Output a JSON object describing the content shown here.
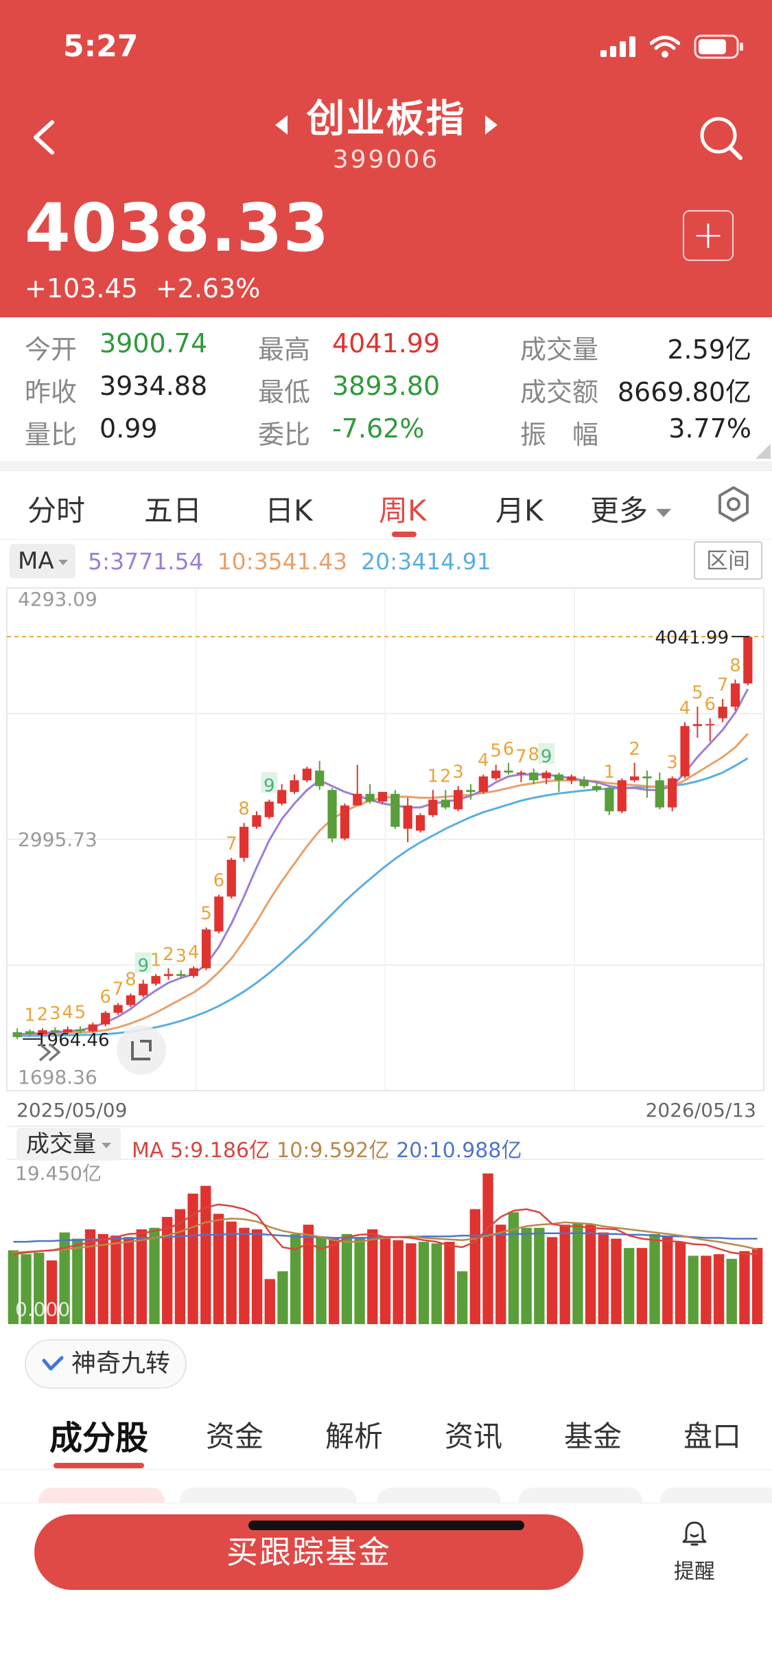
{
  "status": {
    "time": "5:27"
  },
  "header": {
    "title": "创业板指",
    "code": "399006",
    "price": "4038.33",
    "change": "+103.45",
    "change_pct": "+2.63%",
    "add_label": "+"
  },
  "stats": [
    [
      {
        "label": "今开",
        "value": "3900.74",
        "color": "green"
      },
      {
        "label": "最高",
        "value": "4041.99",
        "color": "red"
      },
      {
        "label": "成交量",
        "value": "2.59亿",
        "color": "black"
      }
    ],
    [
      {
        "label": "昨收",
        "value": "3934.88",
        "color": "black"
      },
      {
        "label": "最低",
        "value": "3893.80",
        "color": "green"
      },
      {
        "label": "成交额",
        "value": "8669.80亿",
        "color": "black"
      }
    ],
    [
      {
        "label": "量比",
        "value": "0.99",
        "color": "black"
      },
      {
        "label": "委比",
        "value": "-7.62%",
        "color": "green"
      },
      {
        "label": "振　幅",
        "value": "3.77%",
        "color": "black"
      }
    ]
  ],
  "period_tabs": [
    "分时",
    "五日",
    "日K",
    "周K",
    "月K",
    "更多"
  ],
  "active_period": "周K",
  "ma": {
    "select": "MA",
    "ma5": "5:3771.54",
    "ma10": "10:3541.43",
    "ma20": "20:3414.91",
    "range_btn": "区间"
  },
  "colors": {
    "up": "#e0332f",
    "down": "#5a9e3a",
    "ma5": "#9b7fd6",
    "ma10": "#e8a06a",
    "ma20": "#5aaee0",
    "nine_up": "#e8a53a",
    "nine_down": "#4cb07a",
    "header": "#e04a46"
  },
  "chart_data": {
    "type": "candlestick",
    "ylim": [
      1698.36,
      4293.09
    ],
    "y_labels": [
      "4293.09",
      "2995.73",
      "1698.36"
    ],
    "x_start": "2025/05/09",
    "x_end": "2026/05/13",
    "high_marker": "4041.99",
    "low_marker": "1964.46",
    "candles": [
      [
        2000,
        1975,
        2020,
        1964
      ],
      [
        2005,
        1990,
        2015,
        1980
      ],
      [
        1988,
        2010,
        2020,
        1980
      ],
      [
        2010,
        2000,
        2025,
        1990
      ],
      [
        2000,
        2015,
        2030,
        1995
      ],
      [
        2015,
        2005,
        2030,
        1995
      ],
      [
        2005,
        2040,
        2050,
        2000
      ],
      [
        2040,
        2100,
        2110,
        2030
      ],
      [
        2100,
        2140,
        2150,
        2090
      ],
      [
        2140,
        2190,
        2200,
        2130
      ],
      [
        2190,
        2250,
        2270,
        2180
      ],
      [
        2250,
        2290,
        2300,
        2240
      ],
      [
        2290,
        2300,
        2330,
        2270
      ],
      [
        2300,
        2290,
        2320,
        2280
      ],
      [
        2290,
        2330,
        2340,
        2280
      ],
      [
        2330,
        2530,
        2540,
        2320
      ],
      [
        2520,
        2700,
        2710,
        2510
      ],
      [
        2700,
        2890,
        2900,
        2690
      ],
      [
        2900,
        3060,
        3080,
        2880
      ],
      [
        3060,
        3120,
        3140,
        3050
      ],
      [
        3110,
        3190,
        3200,
        3100
      ],
      [
        3180,
        3250,
        3280,
        3170
      ],
      [
        3240,
        3300,
        3330,
        3230
      ],
      [
        3300,
        3360,
        3370,
        3290
      ],
      [
        3350,
        3270,
        3400,
        3250
      ],
      [
        3250,
        3000,
        3260,
        2980
      ],
      [
        3000,
        3170,
        3180,
        2990
      ],
      [
        3170,
        3230,
        3380,
        3170
      ],
      [
        3230,
        3190,
        3280,
        3180
      ],
      [
        3190,
        3240,
        3240,
        3180
      ],
      [
        3230,
        3060,
        3250,
        3050
      ],
      [
        3050,
        3170,
        3210,
        2980
      ],
      [
        3040,
        3120,
        3130,
        3030
      ],
      [
        3120,
        3200,
        3250,
        3110
      ],
      [
        3200,
        3160,
        3250,
        3150
      ],
      [
        3150,
        3250,
        3270,
        3140
      ],
      [
        3250,
        3240,
        3280,
        3200
      ],
      [
        3240,
        3320,
        3330,
        3230
      ],
      [
        3310,
        3350,
        3380,
        3300
      ],
      [
        3350,
        3340,
        3390,
        3330
      ],
      [
        3340,
        3340,
        3350,
        3290
      ],
      [
        3340,
        3300,
        3360,
        3280
      ],
      [
        3310,
        3340,
        3350,
        3280
      ],
      [
        3330,
        3300,
        3340,
        3240
      ],
      [
        3300,
        3320,
        3330,
        3280
      ],
      [
        3300,
        3270,
        3320,
        3260
      ],
      [
        3270,
        3250,
        3290,
        3240
      ],
      [
        3260,
        3140,
        3270,
        3120
      ],
      [
        3140,
        3300,
        3310,
        3130
      ],
      [
        3300,
        3320,
        3390,
        3290
      ],
      [
        3320,
        3310,
        3350,
        3210
      ],
      [
        3300,
        3160,
        3340,
        3150
      ],
      [
        3160,
        3310,
        3320,
        3140
      ],
      [
        3320,
        3580,
        3600,
        3310
      ],
      [
        3580,
        3590,
        3680,
        3520
      ],
      [
        3590,
        3590,
        3620,
        3500
      ],
      [
        3620,
        3680,
        3720,
        3600
      ],
      [
        3680,
        3800,
        3820,
        3660
      ],
      [
        3800,
        4040,
        4042,
        3790
      ]
    ],
    "nine_counts": [
      {
        "i": 1,
        "n": "1",
        "t": "up"
      },
      {
        "i": 2,
        "n": "2",
        "t": "up"
      },
      {
        "i": 3,
        "n": "3",
        "t": "up"
      },
      {
        "i": 4,
        "n": "4",
        "t": "up"
      },
      {
        "i": 5,
        "n": "5",
        "t": "up"
      },
      {
        "i": 7,
        "n": "6",
        "t": "up"
      },
      {
        "i": 8,
        "n": "7",
        "t": "up"
      },
      {
        "i": 9,
        "n": "8",
        "t": "up"
      },
      {
        "i": 10,
        "n": "9",
        "t": "down"
      },
      {
        "i": 11,
        "n": "1",
        "t": "up"
      },
      {
        "i": 12,
        "n": "2",
        "t": "up"
      },
      {
        "i": 13,
        "n": "3",
        "t": "up"
      },
      {
        "i": 14,
        "n": "4",
        "t": "up"
      },
      {
        "i": 15,
        "n": "5",
        "t": "up"
      },
      {
        "i": 16,
        "n": "6",
        "t": "up"
      },
      {
        "i": 17,
        "n": "7",
        "t": "up"
      },
      {
        "i": 18,
        "n": "8",
        "t": "up"
      },
      {
        "i": 20,
        "n": "9",
        "t": "down"
      },
      {
        "i": 33,
        "n": "1",
        "t": "up"
      },
      {
        "i": 34,
        "n": "2",
        "t": "up"
      },
      {
        "i": 35,
        "n": "3",
        "t": "up"
      },
      {
        "i": 37,
        "n": "4",
        "t": "up"
      },
      {
        "i": 38,
        "n": "5",
        "t": "up"
      },
      {
        "i": 39,
        "n": "6",
        "t": "up"
      },
      {
        "i": 40,
        "n": "7",
        "t": "up"
      },
      {
        "i": 41,
        "n": "8",
        "t": "up"
      },
      {
        "i": 42,
        "n": "9",
        "t": "down"
      },
      {
        "i": 47,
        "n": "1",
        "t": "up"
      },
      {
        "i": 49,
        "n": "2",
        "t": "up"
      },
      {
        "i": 52,
        "n": "3",
        "t": "up"
      },
      {
        "i": 53,
        "n": "4",
        "t": "up"
      },
      {
        "i": 54,
        "n": "5",
        "t": "up"
      },
      {
        "i": 55,
        "n": "6",
        "t": "up"
      },
      {
        "i": 56,
        "n": "7",
        "t": "up"
      },
      {
        "i": 57,
        "n": "8",
        "t": "up"
      }
    ],
    "ma5": [
      1990,
      1992,
      1995,
      2000,
      2005,
      2010,
      2025,
      2050,
      2080,
      2120,
      2170,
      2215,
      2255,
      2280,
      2300,
      2350,
      2440,
      2560,
      2700,
      2850,
      2990,
      3100,
      3180,
      3250,
      3300,
      3270,
      3240,
      3220,
      3200,
      3180,
      3170,
      3160,
      3160,
      3180,
      3190,
      3200,
      3220,
      3250,
      3290,
      3320,
      3330,
      3330,
      3330,
      3320,
      3310,
      3300,
      3290,
      3270,
      3260,
      3260,
      3250,
      3250,
      3270,
      3340,
      3420,
      3490,
      3560,
      3650,
      3771
    ],
    "ma10": [
      1985,
      1988,
      1990,
      1992,
      1995,
      1998,
      2002,
      2010,
      2025,
      2045,
      2070,
      2100,
      2135,
      2170,
      2205,
      2250,
      2310,
      2380,
      2470,
      2570,
      2680,
      2780,
      2870,
      2960,
      3040,
      3100,
      3140,
      3170,
      3195,
      3210,
      3215,
      3215,
      3210,
      3210,
      3215,
      3220,
      3225,
      3235,
      3245,
      3260,
      3275,
      3285,
      3295,
      3300,
      3300,
      3300,
      3295,
      3285,
      3280,
      3275,
      3270,
      3265,
      3270,
      3300,
      3340,
      3380,
      3420,
      3470,
      3541
    ],
    "ma20": [
      1980,
      1981,
      1982,
      1983,
      1984,
      1985,
      1987,
      1990,
      1995,
      2002,
      2012,
      2025,
      2040,
      2058,
      2080,
      2105,
      2135,
      2170,
      2210,
      2255,
      2305,
      2360,
      2420,
      2480,
      2545,
      2610,
      2675,
      2735,
      2790,
      2845,
      2895,
      2940,
      2980,
      3015,
      3050,
      3080,
      3110,
      3135,
      3155,
      3175,
      3195,
      3210,
      3222,
      3232,
      3240,
      3247,
      3253,
      3257,
      3260,
      3263,
      3265,
      3268,
      3272,
      3280,
      3295,
      3315,
      3340,
      3375,
      3414
    ]
  },
  "volume": {
    "select": "成交量",
    "ma5": "MA 5:9.186亿",
    "ma10": "10:9.592亿",
    "ma20": "20:10.988亿",
    "max_label": "19.450亿",
    "min_label": "0.000",
    "bars": [
      {
        "v": 9.5,
        "t": "down"
      },
      {
        "v": 9.0,
        "t": "down"
      },
      {
        "v": 9.2,
        "t": "down"
      },
      {
        "v": 8.2,
        "t": "up"
      },
      {
        "v": 11.8,
        "t": "down"
      },
      {
        "v": 11.0,
        "t": "down"
      },
      {
        "v": 12.2,
        "t": "up"
      },
      {
        "v": 11.6,
        "t": "up"
      },
      {
        "v": 11.4,
        "t": "up"
      },
      {
        "v": 11.2,
        "t": "up"
      },
      {
        "v": 12.2,
        "t": "up"
      },
      {
        "v": 12.4,
        "t": "down"
      },
      {
        "v": 13.8,
        "t": "up"
      },
      {
        "v": 14.8,
        "t": "up"
      },
      {
        "v": 16.8,
        "t": "up"
      },
      {
        "v": 17.8,
        "t": "up"
      },
      {
        "v": 14.2,
        "t": "up"
      },
      {
        "v": 13.2,
        "t": "up"
      },
      {
        "v": 12.4,
        "t": "up"
      },
      {
        "v": 12.2,
        "t": "up"
      },
      {
        "v": 5.8,
        "t": "up"
      },
      {
        "v": 6.8,
        "t": "down"
      },
      {
        "v": 11.6,
        "t": "down"
      },
      {
        "v": 12.8,
        "t": "up"
      },
      {
        "v": 11.2,
        "t": "down"
      },
      {
        "v": 11.0,
        "t": "up"
      },
      {
        "v": 11.6,
        "t": "down"
      },
      {
        "v": 11.2,
        "t": "down"
      },
      {
        "v": 12.2,
        "t": "up"
      },
      {
        "v": 11.0,
        "t": "up"
      },
      {
        "v": 10.8,
        "t": "up"
      },
      {
        "v": 10.4,
        "t": "up"
      },
      {
        "v": 10.6,
        "t": "down"
      },
      {
        "v": 10.4,
        "t": "down"
      },
      {
        "v": 10.6,
        "t": "up"
      },
      {
        "v": 6.8,
        "t": "down"
      },
      {
        "v": 14.8,
        "t": "up"
      },
      {
        "v": 19.4,
        "t": "up"
      },
      {
        "v": 12.8,
        "t": "up"
      },
      {
        "v": 14.4,
        "t": "down"
      },
      {
        "v": 12.4,
        "t": "down"
      },
      {
        "v": 12.4,
        "t": "down"
      },
      {
        "v": 11.2,
        "t": "up"
      },
      {
        "v": 12.8,
        "t": "up"
      },
      {
        "v": 13.0,
        "t": "down"
      },
      {
        "v": 12.8,
        "t": "up"
      },
      {
        "v": 11.8,
        "t": "up"
      },
      {
        "v": 11.0,
        "t": "up"
      },
      {
        "v": 9.8,
        "t": "down"
      },
      {
        "v": 9.8,
        "t": "up"
      },
      {
        "v": 11.6,
        "t": "down"
      },
      {
        "v": 11.4,
        "t": "up"
      },
      {
        "v": 10.6,
        "t": "up"
      },
      {
        "v": 8.8,
        "t": "down"
      },
      {
        "v": 8.8,
        "t": "up"
      },
      {
        "v": 9.0,
        "t": "up"
      },
      {
        "v": 8.4,
        "t": "down"
      },
      {
        "v": 9.4,
        "t": "up"
      },
      {
        "v": 9.8,
        "t": "up"
      }
    ],
    "ma5_line": [
      9.0,
      9.2,
      9.4,
      9.5,
      9.8,
      10.2,
      10.5,
      10.9,
      11.2,
      11.6,
      11.7,
      12.0,
      12.3,
      13.0,
      14.1,
      15.0,
      15.4,
      15.2,
      14.8,
      14.0,
      11.8,
      9.9,
      9.6,
      10.4,
      9.7,
      10.2,
      11.2,
      11.5,
      11.6,
      11.2,
      11.2,
      11.1,
      10.8,
      10.6,
      10.1,
      9.9,
      10.6,
      12.4,
      13.8,
      14.6,
      14.8,
      14.4,
      12.9,
      12.6,
      12.6,
      12.4,
      12.3,
      12.2,
      11.4,
      11.0,
      10.8,
      10.7,
      10.6,
      10.3,
      10.2,
      9.7,
      9.2,
      9.0,
      9.1
    ],
    "ma10_line": [
      9.2,
      9.3,
      9.4,
      9.5,
      9.6,
      9.8,
      10.0,
      10.2,
      10.4,
      10.6,
      10.8,
      11.1,
      11.4,
      11.9,
      12.5,
      13.1,
      13.4,
      13.6,
      13.5,
      13.2,
      12.5,
      12.0,
      11.7,
      11.5,
      11.2,
      10.8,
      10.6,
      10.6,
      10.9,
      11.1,
      11.2,
      11.3,
      11.1,
      11.0,
      10.9,
      10.8,
      11.0,
      11.4,
      11.8,
      12.2,
      12.6,
      12.8,
      12.9,
      13.1,
      13.0,
      12.9,
      12.6,
      12.4,
      12.2,
      12.0,
      11.8,
      11.6,
      11.4,
      11.1,
      10.8,
      10.6,
      10.3,
      10.0,
      9.6
    ],
    "ma20_line": [
      10.6,
      10.6,
      10.7,
      10.7,
      10.8,
      10.8,
      10.9,
      10.9,
      11.0,
      11.0,
      11.1,
      11.1,
      11.2,
      11.3,
      11.4,
      11.5,
      11.5,
      11.6,
      11.6,
      11.6,
      11.5,
      11.4,
      11.3,
      11.2,
      11.2,
      11.1,
      11.1,
      11.1,
      11.1,
      11.2,
      11.2,
      11.2,
      11.3,
      11.3,
      11.3,
      11.4,
      11.4,
      11.5,
      11.5,
      11.6,
      11.6,
      11.7,
      11.7,
      11.7,
      11.7,
      11.7,
      11.6,
      11.6,
      11.5,
      11.5,
      11.4,
      11.3,
      11.3,
      11.2,
      11.1,
      11.1,
      11.0,
      11.0,
      11.0
    ]
  },
  "magic_chip": "神奇九转",
  "sub_tabs": [
    "成分股",
    "资金",
    "解析",
    "资讯",
    "基金",
    "盘口"
  ],
  "bottom": {
    "buy_label": "买跟踪基金",
    "remind_label": "提醒"
  }
}
